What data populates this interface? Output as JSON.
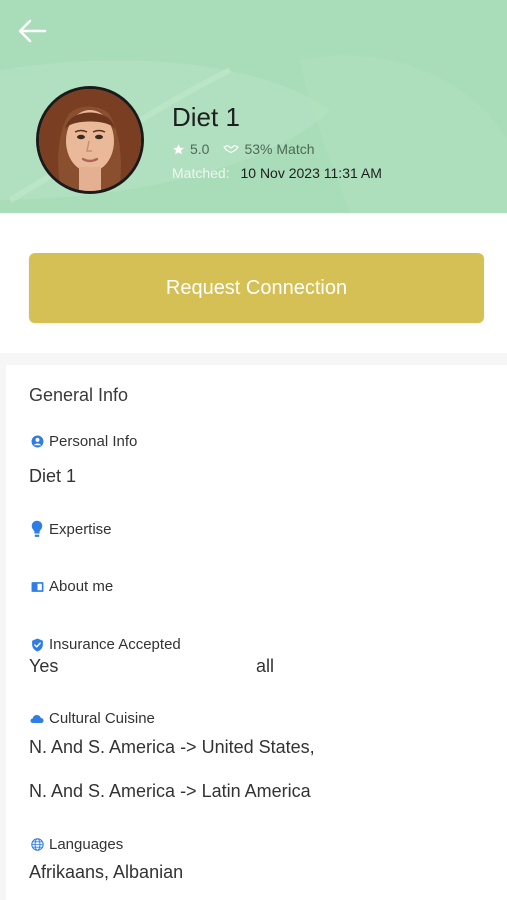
{
  "profile": {
    "name": "Diet 1",
    "rating": "5.0",
    "match": "53% Match",
    "matched_label": "Matched:",
    "matched_date": "10 Nov 2023 11:31 AM"
  },
  "actions": {
    "request_connection": "Request Connection"
  },
  "general_info": {
    "title": "General Info",
    "personal_info": {
      "label": "Personal Info",
      "value": "Diet 1",
      "icon": "person-icon"
    },
    "expertise": {
      "label": "Expertise",
      "icon": "lightbulb-icon"
    },
    "about_me": {
      "label": "About me",
      "icon": "book-icon"
    },
    "insurance": {
      "label": "Insurance Accepted",
      "value": "Yes",
      "extra": "all",
      "icon": "shield-check-icon"
    },
    "cuisine": {
      "label": "Cultural Cuisine",
      "values": [
        "N. And S. America -> United States,",
        "N. And S. America -> Latin America"
      ],
      "icon": "cloud-icon"
    },
    "languages": {
      "label": "Languages",
      "value": "Afrikaans, Albanian",
      "icon": "globe-icon"
    }
  },
  "colors": {
    "header_bg": "#a9dcb8",
    "button_bg": "#d4c054",
    "icon_blue": "#2f7ee6"
  }
}
